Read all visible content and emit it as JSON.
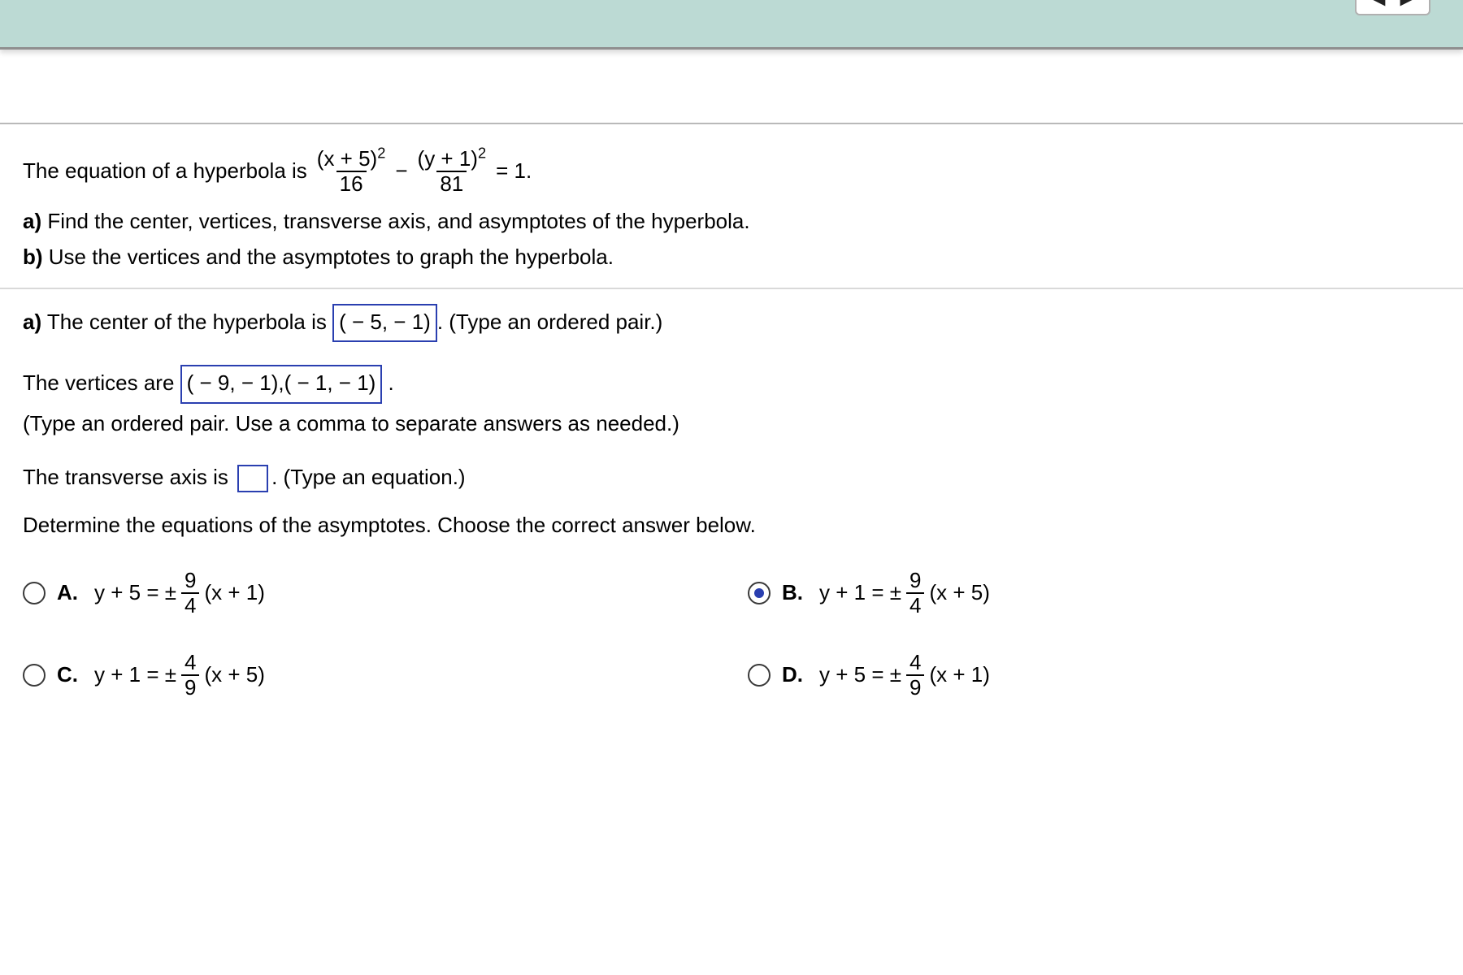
{
  "topbar": {
    "prev_glyph": "◀",
    "next_glyph": "▶"
  },
  "intro": {
    "lead": "The equation of a hyperbola is",
    "eq": {
      "num1": "(x + 5)",
      "sup1": "2",
      "den1": "16",
      "minus": "−",
      "num2": "(y + 1)",
      "sup2": "2",
      "den2": "81",
      "tail": " = 1."
    },
    "part_a_label": "a)",
    "part_a_text": " Find the center, vertices, transverse axis, and asymptotes of the hyperbola.",
    "part_b_label": "b)",
    "part_b_text": " Use the vertices and the asymptotes to graph the hyperbola."
  },
  "answers": {
    "a_label": "a)",
    "center_pre": "  The center of the hyperbola is ",
    "center_value": "( − 5, − 1)",
    "center_post": ". (Type an ordered pair.)",
    "vertices_pre": "The vertices are ",
    "vertices_value": "( − 9, − 1),( − 1, − 1)",
    "vertices_post": " .",
    "vertices_note": "(Type an ordered pair. Use a comma to separate answers as needed.)",
    "transverse_pre": "The transverse axis is ",
    "transverse_post": ". (Type an equation.)",
    "asymptote_prompt": "Determine the equations of the asymptotes. Choose the correct answer below."
  },
  "mc": {
    "A": {
      "letter": "A.",
      "lhs": "y + 5 =  ± ",
      "num": "9",
      "den": "4",
      "rhs": "(x + 1)",
      "selected": false
    },
    "B": {
      "letter": "B.",
      "lhs": "y + 1 =  ± ",
      "num": "9",
      "den": "4",
      "rhs": "(x + 5)",
      "selected": true
    },
    "C": {
      "letter": "C.",
      "lhs": "y + 1 =  ± ",
      "num": "4",
      "den": "9",
      "rhs": "(x + 5)",
      "selected": false
    },
    "D": {
      "letter": "D.",
      "lhs": "y + 5 =  ± ",
      "num": "4",
      "den": "9",
      "rhs": "(x + 1)",
      "selected": false
    }
  }
}
